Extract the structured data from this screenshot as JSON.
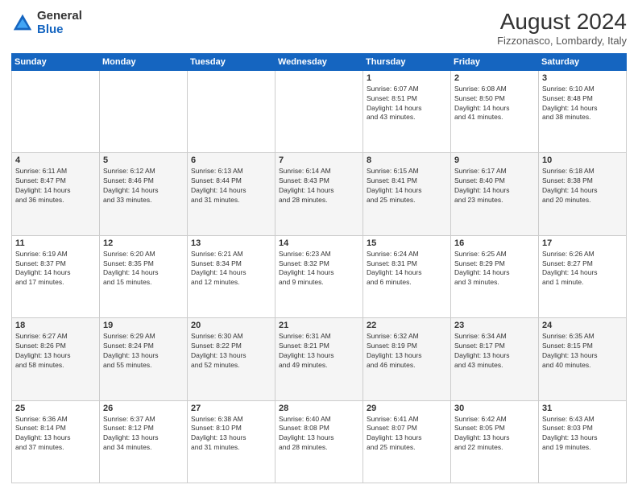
{
  "header": {
    "logo": {
      "general": "General",
      "blue": "Blue"
    },
    "title": "August 2024",
    "location": "Fizzonasco, Lombardy, Italy"
  },
  "calendar": {
    "days_of_week": [
      "Sunday",
      "Monday",
      "Tuesday",
      "Wednesday",
      "Thursday",
      "Friday",
      "Saturday"
    ],
    "weeks": [
      [
        {
          "day": "",
          "info": ""
        },
        {
          "day": "",
          "info": ""
        },
        {
          "day": "",
          "info": ""
        },
        {
          "day": "",
          "info": ""
        },
        {
          "day": "1",
          "info": "Sunrise: 6:07 AM\nSunset: 8:51 PM\nDaylight: 14 hours\nand 43 minutes."
        },
        {
          "day": "2",
          "info": "Sunrise: 6:08 AM\nSunset: 8:50 PM\nDaylight: 14 hours\nand 41 minutes."
        },
        {
          "day": "3",
          "info": "Sunrise: 6:10 AM\nSunset: 8:48 PM\nDaylight: 14 hours\nand 38 minutes."
        }
      ],
      [
        {
          "day": "4",
          "info": "Sunrise: 6:11 AM\nSunset: 8:47 PM\nDaylight: 14 hours\nand 36 minutes."
        },
        {
          "day": "5",
          "info": "Sunrise: 6:12 AM\nSunset: 8:46 PM\nDaylight: 14 hours\nand 33 minutes."
        },
        {
          "day": "6",
          "info": "Sunrise: 6:13 AM\nSunset: 8:44 PM\nDaylight: 14 hours\nand 31 minutes."
        },
        {
          "day": "7",
          "info": "Sunrise: 6:14 AM\nSunset: 8:43 PM\nDaylight: 14 hours\nand 28 minutes."
        },
        {
          "day": "8",
          "info": "Sunrise: 6:15 AM\nSunset: 8:41 PM\nDaylight: 14 hours\nand 25 minutes."
        },
        {
          "day": "9",
          "info": "Sunrise: 6:17 AM\nSunset: 8:40 PM\nDaylight: 14 hours\nand 23 minutes."
        },
        {
          "day": "10",
          "info": "Sunrise: 6:18 AM\nSunset: 8:38 PM\nDaylight: 14 hours\nand 20 minutes."
        }
      ],
      [
        {
          "day": "11",
          "info": "Sunrise: 6:19 AM\nSunset: 8:37 PM\nDaylight: 14 hours\nand 17 minutes."
        },
        {
          "day": "12",
          "info": "Sunrise: 6:20 AM\nSunset: 8:35 PM\nDaylight: 14 hours\nand 15 minutes."
        },
        {
          "day": "13",
          "info": "Sunrise: 6:21 AM\nSunset: 8:34 PM\nDaylight: 14 hours\nand 12 minutes."
        },
        {
          "day": "14",
          "info": "Sunrise: 6:23 AM\nSunset: 8:32 PM\nDaylight: 14 hours\nand 9 minutes."
        },
        {
          "day": "15",
          "info": "Sunrise: 6:24 AM\nSunset: 8:31 PM\nDaylight: 14 hours\nand 6 minutes."
        },
        {
          "day": "16",
          "info": "Sunrise: 6:25 AM\nSunset: 8:29 PM\nDaylight: 14 hours\nand 3 minutes."
        },
        {
          "day": "17",
          "info": "Sunrise: 6:26 AM\nSunset: 8:27 PM\nDaylight: 14 hours\nand 1 minute."
        }
      ],
      [
        {
          "day": "18",
          "info": "Sunrise: 6:27 AM\nSunset: 8:26 PM\nDaylight: 13 hours\nand 58 minutes."
        },
        {
          "day": "19",
          "info": "Sunrise: 6:29 AM\nSunset: 8:24 PM\nDaylight: 13 hours\nand 55 minutes."
        },
        {
          "day": "20",
          "info": "Sunrise: 6:30 AM\nSunset: 8:22 PM\nDaylight: 13 hours\nand 52 minutes."
        },
        {
          "day": "21",
          "info": "Sunrise: 6:31 AM\nSunset: 8:21 PM\nDaylight: 13 hours\nand 49 minutes."
        },
        {
          "day": "22",
          "info": "Sunrise: 6:32 AM\nSunset: 8:19 PM\nDaylight: 13 hours\nand 46 minutes."
        },
        {
          "day": "23",
          "info": "Sunrise: 6:34 AM\nSunset: 8:17 PM\nDaylight: 13 hours\nand 43 minutes."
        },
        {
          "day": "24",
          "info": "Sunrise: 6:35 AM\nSunset: 8:15 PM\nDaylight: 13 hours\nand 40 minutes."
        }
      ],
      [
        {
          "day": "25",
          "info": "Sunrise: 6:36 AM\nSunset: 8:14 PM\nDaylight: 13 hours\nand 37 minutes."
        },
        {
          "day": "26",
          "info": "Sunrise: 6:37 AM\nSunset: 8:12 PM\nDaylight: 13 hours\nand 34 minutes."
        },
        {
          "day": "27",
          "info": "Sunrise: 6:38 AM\nSunset: 8:10 PM\nDaylight: 13 hours\nand 31 minutes."
        },
        {
          "day": "28",
          "info": "Sunrise: 6:40 AM\nSunset: 8:08 PM\nDaylight: 13 hours\nand 28 minutes."
        },
        {
          "day": "29",
          "info": "Sunrise: 6:41 AM\nSunset: 8:07 PM\nDaylight: 13 hours\nand 25 minutes."
        },
        {
          "day": "30",
          "info": "Sunrise: 6:42 AM\nSunset: 8:05 PM\nDaylight: 13 hours\nand 22 minutes."
        },
        {
          "day": "31",
          "info": "Sunrise: 6:43 AM\nSunset: 8:03 PM\nDaylight: 13 hours\nand 19 minutes."
        }
      ]
    ]
  }
}
